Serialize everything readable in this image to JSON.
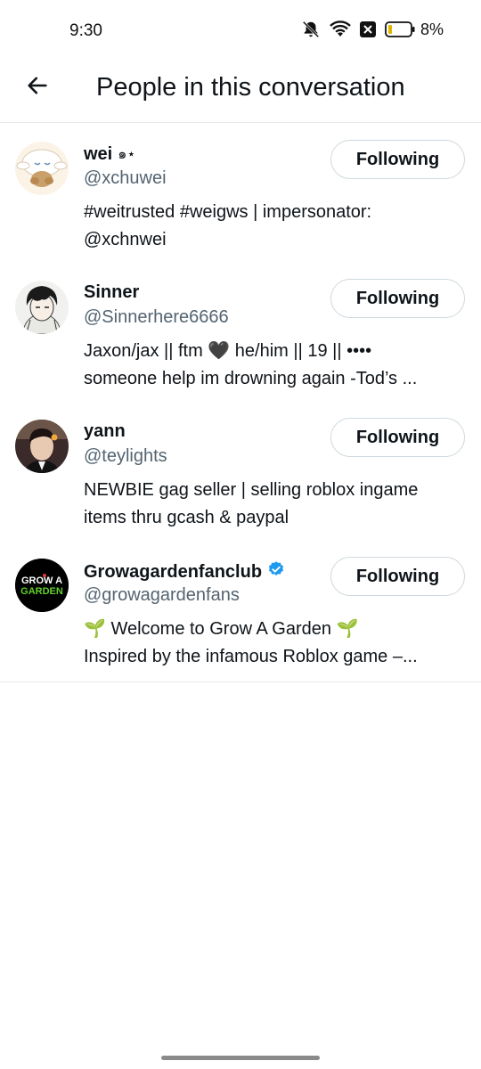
{
  "status_bar": {
    "time": "9:30",
    "battery_percent": "8%",
    "icons": [
      "bell-muted-icon",
      "wifi-icon",
      "x-box-icon",
      "battery-icon"
    ]
  },
  "header": {
    "back_icon": "arrow-left-icon",
    "title": "People in this conversation"
  },
  "users": [
    {
      "name": "wei",
      "name_suffix": "๑⋆",
      "handle": "@xchuwei",
      "bio_line1": "#weitrusted #weigws | impersonator:",
      "bio_line2": "@xchnwei",
      "button": "Following",
      "avatar": "cinnamoroll-avatar"
    },
    {
      "name": "Sinner",
      "name_suffix": "",
      "handle": "@Sinnerhere6666",
      "bio_line1": "Jaxon/jax || ftm 🖤 he/him || 19 || ••••",
      "bio_line2": "someone help im drowning again -Tod’s ...",
      "button": "Following",
      "avatar": "anime-boy-avatar"
    },
    {
      "name": "yann",
      "name_suffix": "",
      "handle": "@teylights",
      "bio_line1": "NEWBIE gag seller | selling roblox ingame",
      "bio_line2": "items thru gcash & paypal",
      "button": "Following",
      "avatar": "photo-avatar"
    },
    {
      "name": "Growagardenfanclub",
      "name_suffix": "",
      "verified": true,
      "handle": "@growagardenfans",
      "bio_line1": "🌱 Welcome to Grow A Garden 🌱",
      "bio_line2": "Inspired by the infamous Roblox game –...",
      "button": "Following",
      "avatar": "grow-a-garden-logo",
      "avatar_text_top": "GROW A",
      "avatar_text_bottom": "GARDEN"
    }
  ],
  "colors": {
    "text_primary": "#0f1419",
    "text_secondary": "#536471",
    "border": "#cfd9de",
    "verified_blue": "#1d9bf0"
  }
}
